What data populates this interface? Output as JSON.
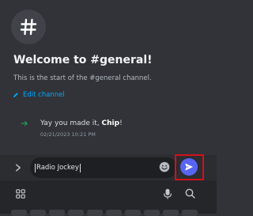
{
  "channel": {
    "icon": "hash-icon",
    "welcome_title": "Welcome to #general!",
    "start_text": "This is the start of the #general channel.",
    "edit_label": "Edit channel"
  },
  "system_message": {
    "icon": "arrow-right-icon",
    "prefix": "Yay you made it, ",
    "user": "Chip",
    "suffix": "!",
    "timestamp": "02/21/2023 10:21 PM"
  },
  "composer": {
    "input_value": "Radio Jockey",
    "send_icon": "send-icon",
    "emoji_icon": "emoji-icon",
    "expand_icon": "chevron-right-icon"
  },
  "keyboard_toolbar": {
    "icons": [
      "apps-grid-icon",
      "microphone-icon",
      "search-icon"
    ]
  },
  "colors": {
    "background": "#313338",
    "accent": "#5865f2",
    "link": "#00a8fc",
    "highlight": "#d4101b"
  }
}
